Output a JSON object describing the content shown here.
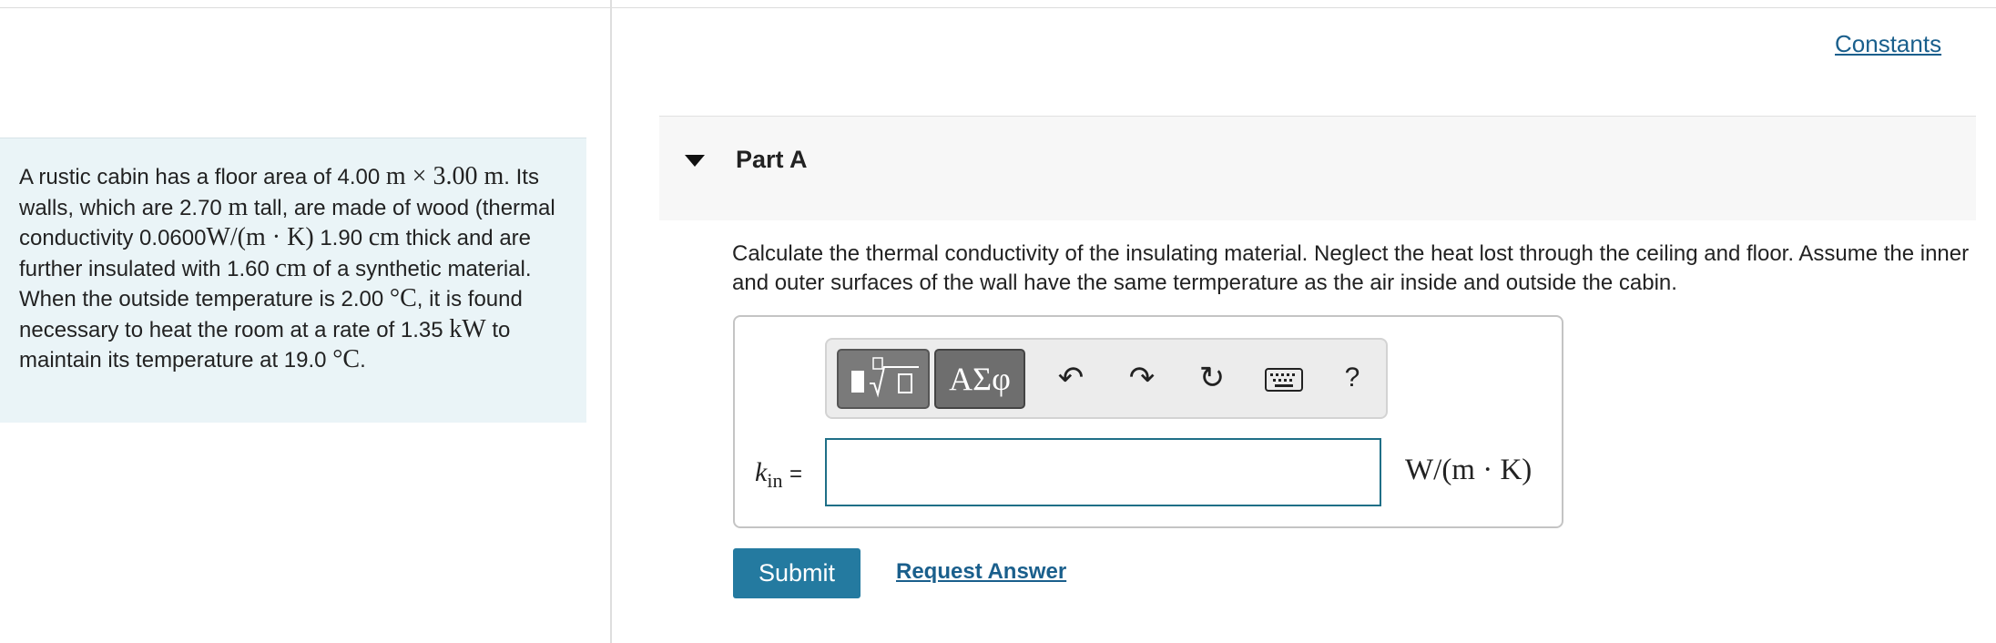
{
  "problem": {
    "t1": "A rustic cabin has a floor area of 4.00 ",
    "m1": "m × 3.00 m",
    "t2": ". Its walls, which are 2.70 ",
    "m2": "m",
    "t3": " tall, are made of wood (thermal conductivity 0.0600",
    "m3": "W/(m · K)",
    "t4": " 1.90 ",
    "m4": "cm",
    "t5": " thick and are further insulated with 1.60 ",
    "m5": "cm",
    "t6": " of a synthetic material. When the outside temperature is 2.00 ",
    "m6": "°C",
    "t7": ", it is found necessary to heat the room at a rate of 1.35 ",
    "m7": "kW",
    "t8": " to maintain its temperature at 19.0 ",
    "m8": "°C",
    "t9": "."
  },
  "header": {
    "constants_link": "Constants"
  },
  "part": {
    "title": "Part A",
    "question": "Calculate the thermal conductivity of the insulating material. Neglect the heat lost through the ceiling and floor. Assume the inner and outer surfaces of the wall have the same termperature as the air inside and outside the cabin."
  },
  "toolbar": {
    "greek_label": "ΑΣφ",
    "undo_glyph": "↶",
    "redo_glyph": "↷",
    "reset_glyph": "↻",
    "help_label": "?",
    "icons": [
      "templates-icon",
      "greek-symbols-icon",
      "undo-icon",
      "redo-icon",
      "reset-icon",
      "keyboard-icon",
      "help-icon"
    ]
  },
  "answer": {
    "var": "k",
    "sub": "in",
    "equals": "=",
    "value": "",
    "placeholder": "",
    "units": "W/(m · K)"
  },
  "actions": {
    "submit": "Submit",
    "request": "Request Answer"
  },
  "colors": {
    "accent": "#247aa0",
    "link": "#1a5f8c",
    "problem_bg": "#eaf4f7",
    "input_border": "#1f6f87"
  }
}
